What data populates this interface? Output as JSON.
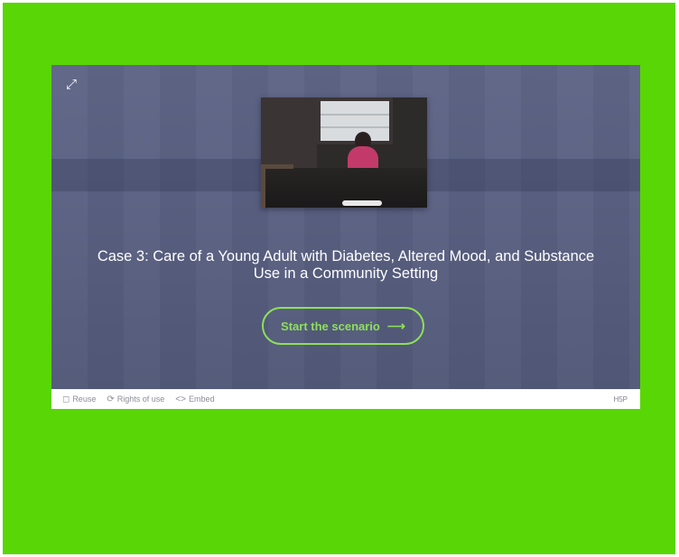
{
  "player": {
    "expand_icon": "expand-icon",
    "cover_image_alt": "woman-at-table-image",
    "title": "Case 3: Care of a Young Adult with Diabetes, Altered Mood, and Substance Use in a Community Setting",
    "start_label": "Start the scenario",
    "start_icon": "arrow-right-icon"
  },
  "footer": {
    "reuse_label": "Reuse",
    "rights_label": "Rights of use",
    "embed_label": "Embed",
    "logo_text": "H5P"
  },
  "colors": {
    "page_background": "#58d605",
    "stage_background": "#596082",
    "accent_green": "#8de05a",
    "footer_background": "#ffffff"
  }
}
